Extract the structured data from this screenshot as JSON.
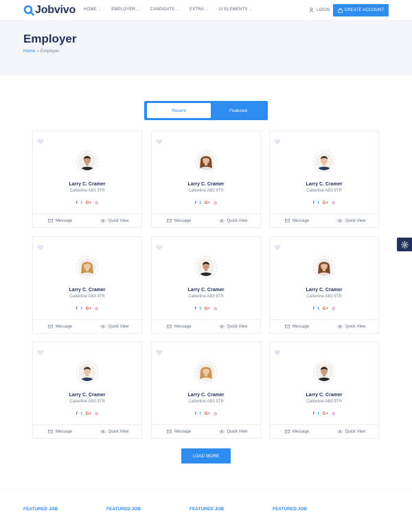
{
  "brand": {
    "name": "Jobvivo",
    "accent": "#2e8cf0",
    "navy": "#22325a"
  },
  "nav": [
    {
      "label": "HOME"
    },
    {
      "label": "EMPLOYER"
    },
    {
      "label": "CANDIDATE"
    },
    {
      "label": "EXTRA"
    },
    {
      "label": "UI ELEMENTS"
    }
  ],
  "header": {
    "login_label": "LOGIN",
    "cta_label": "CREATE ACCOUNT"
  },
  "page": {
    "title": "Employer",
    "breadcrumb_home": "Home",
    "breadcrumb_sep": "»",
    "breadcrumb_current": "Employer"
  },
  "tabs": {
    "recent": "Recent",
    "featured": "Featured"
  },
  "cards": [
    {
      "name": "Larry C. Cramer",
      "address": "Catterline AB3 9TR",
      "message_label": "Message",
      "view_label": "Quick View",
      "avatar": "man-dark"
    },
    {
      "name": "Larry C. Cramer",
      "address": "Catterline AB3 9TR",
      "message_label": "Message",
      "view_label": "Quick View",
      "avatar": "woman-brown"
    },
    {
      "name": "Larry C. Cramer",
      "address": "Catterline AB3 9TR",
      "message_label": "Message",
      "view_label": "Quick View",
      "avatar": "man-suit"
    },
    {
      "name": "Larry C. Cramer",
      "address": "Catterline AB3 9TR",
      "message_label": "Message",
      "view_label": "Quick View",
      "avatar": "woman-blonde"
    },
    {
      "name": "Larry C. Cramer",
      "address": "Catterline AB3 9TR",
      "message_label": "Message",
      "view_label": "Quick View",
      "avatar": "man-dark"
    },
    {
      "name": "Larry C. Cramer",
      "address": "Catterline AB3 9TR",
      "message_label": "Message",
      "view_label": "Quick View",
      "avatar": "woman-brown"
    },
    {
      "name": "Larry C. Cramer",
      "address": "Catterline AB3 9TR",
      "message_label": "Message",
      "view_label": "Quick View",
      "avatar": "man-suit"
    },
    {
      "name": "Larry C. Cramer",
      "address": "Catterline AB3 9TR",
      "message_label": "Message",
      "view_label": "Quick View",
      "avatar": "woman-blonde"
    },
    {
      "name": "Larry C. Cramer",
      "address": "Catterline AB3 9TR",
      "message_label": "Message",
      "view_label": "Quick View",
      "avatar": "man-dark"
    }
  ],
  "socials": {
    "facebook": "f",
    "twitter": "t",
    "google": "G+",
    "instagram": "◎"
  },
  "load_more_label": "LOAD MORE",
  "footer": {
    "col1": "FEATURED JOB",
    "col2": "FEATURED JOB",
    "col3": "FEATURED JOB",
    "col4": "FEATURED JOB"
  }
}
